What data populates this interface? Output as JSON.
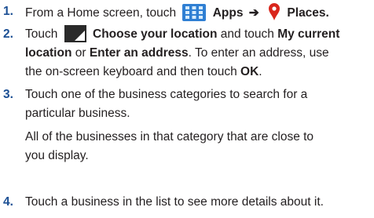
{
  "steps": [
    {
      "number": "1.",
      "text_a": "From a Home screen, touch",
      "apps": "Apps",
      "arrow": "➔",
      "places": "Places.",
      "icons": [
        "apps-grid-icon",
        "map-pin-icon"
      ]
    },
    {
      "number": "2.",
      "touch": "Touch",
      "choose": "Choose your location",
      "and_touch": "and touch",
      "my_current": "My current",
      "location": "location",
      "or": "or",
      "enter_address": "Enter an address",
      "rest_line2": ". To enter an address, use",
      "line3_a": "the on-screen keyboard and then touch",
      "ok": "OK",
      "line3_end": ".",
      "icons": [
        "location-selector-icon"
      ]
    },
    {
      "number": "3.",
      "line1": "Touch one of the business categories to search for a",
      "line2": "particular business.",
      "line3": "All of the businesses in that category that are close to",
      "line4": "you display."
    },
    {
      "number": "4.",
      "line1": "Touch a business in the list to see more details about it."
    }
  ],
  "colors": {
    "step_number": "#1b4f94",
    "apps_icon": "#2f7fd3",
    "pin_red": "#d9261c",
    "location_icon_bg": "#2a2a2a"
  }
}
